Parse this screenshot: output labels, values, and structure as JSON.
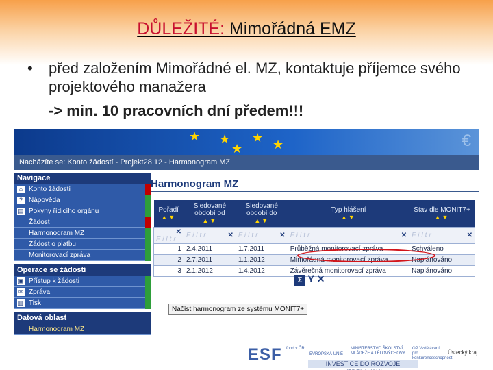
{
  "slide": {
    "title_prefix": "DŮLEŽITÉ:",
    "title_main": " Mimořádná EMZ",
    "bullet_symbol": "•",
    "bullet_text": "před založením Mimořádné el. MZ, kontaktuje příjemce svého projektového manažera",
    "bullet_strong": "-> min. 10 pracovních dní předem!!!"
  },
  "app": {
    "breadcrumb": "Nacházíte se: Konto žádostí - Projekt28 12 - Harmonogram MZ",
    "sidebar": {
      "sections": [
        {
          "title": "Navigace",
          "items": [
            {
              "label": "Konto žádostí",
              "icon": "home-icon",
              "glyph": "⌂",
              "mark": "#c00000"
            },
            {
              "label": "Nápověda",
              "icon": "help-icon",
              "glyph": "?",
              "mark": "#2e9e3a"
            },
            {
              "label": "Pokyny řídicího orgánu",
              "icon": "book-icon",
              "glyph": "▤",
              "mark": "#2e9e3a"
            },
            {
              "label": "Žádost",
              "icon": "",
              "glyph": "",
              "mark": "#c00000"
            },
            {
              "label": "Harmonogram MZ",
              "icon": "",
              "glyph": "",
              "mark": "#2e9e3a"
            },
            {
              "label": "Žádost o platbu",
              "icon": "",
              "glyph": "",
              "mark": "#2e9e3a"
            },
            {
              "label": "Monitorovací zpráva",
              "icon": "",
              "glyph": "",
              "mark": "#2e9e3a"
            }
          ]
        },
        {
          "title": "Operace se žádostí",
          "items": [
            {
              "label": "Přístup k žádosti",
              "icon": "lock-icon",
              "glyph": "▣",
              "mark": "#2e9e3a"
            },
            {
              "label": "Zpráva",
              "icon": "mail-icon",
              "glyph": "✉",
              "mark": "#2e9e3a"
            },
            {
              "label": "Tisk",
              "icon": "print-icon",
              "glyph": "▥",
              "mark": "#2e9e3a"
            }
          ]
        },
        {
          "title": "Datová oblast",
          "items": [
            {
              "label": "Harmonogram MZ",
              "icon": "",
              "glyph": "",
              "mark": "",
              "active": true
            }
          ]
        }
      ]
    },
    "main": {
      "title": "Harmonogram MZ",
      "columns": [
        "Pořadí",
        "Sledované období od",
        "Sledované období do",
        "Typ hlášení",
        "Stav dle MONIT7+"
      ],
      "filter_text": "Filtr",
      "rows": [
        [
          "1",
          "2.4.2011",
          "1.7.2011",
          "Průběžná monitorovací zpráva",
          "Schváleno"
        ],
        [
          "2",
          "2.7.2011",
          "1.1.2012",
          "Mimořádná monitorovací zpráva",
          "Naplánováno"
        ],
        [
          "3",
          "2.1.2012",
          "1.4.2012",
          "Závěrečná monitorovací zpráva",
          "Naplánováno"
        ]
      ],
      "load_button": "Načíst harmonogram ze systému MONIT7+"
    }
  },
  "footer": {
    "esf_mark": "ESF",
    "esf_sub": "fond v ČR",
    "eu_text": "EVROPSKÁ UNIE",
    "ministry": "MINISTERSTVO ŠKOLSTVÍ, MLÁDEŽE A TĚLOVÝCHOVY",
    "op_text": "OP Vzdělávání pro konkurenceschopnost",
    "band": "INVESTICE DO ROZVOJE VZDĚLÁVÁNÍ",
    "region": "Ústecký kraj"
  },
  "colors": {
    "title_red": "#c8102e",
    "app_navy": "#1d3a7a",
    "sidebar_blue": "#2f5aa8",
    "highlight_red": "#d2141a"
  }
}
